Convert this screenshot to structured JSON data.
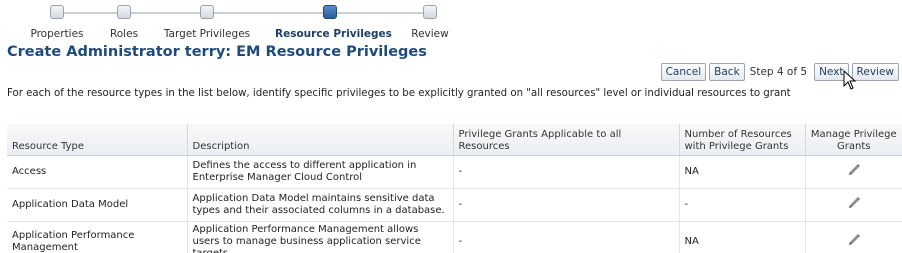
{
  "train": {
    "steps": [
      {
        "label": "Properties"
      },
      {
        "label": "Roles"
      },
      {
        "label": "Target Privileges"
      },
      {
        "label": "Resource Privileges"
      },
      {
        "label": "Review"
      }
    ],
    "current_index": 3
  },
  "page_title": "Create Administrator terry: EM Resource Privileges",
  "buttons": {
    "cancel": "Cancel",
    "back": "Back",
    "step_text": "Step 4 of 5",
    "next": "Next",
    "review": "Review"
  },
  "instructions": "For each of the resource types in the list below, identify specific privileges to be explicitly granted on \"all resources\" level or individual resources to grant",
  "table": {
    "columns": {
      "resource_type": "Resource Type",
      "description": "Description",
      "privilege_grants": "Privilege Grants Applicable to all Resources",
      "num_resources": "Number of Resources with Privilege Grants",
      "manage": "Manage Privilege Grants"
    },
    "rows": [
      {
        "resource_type": "Access",
        "description": "Defines the access to different application in Enterprise Manager Cloud Control",
        "privilege_grants": "-",
        "num_resources": "NA",
        "manage_icon": "pencil-icon"
      },
      {
        "resource_type": "Application Data Model",
        "description": "Application Data Model maintains sensitive data types and their associated columns in a database.",
        "privilege_grants": "-",
        "num_resources": "-",
        "manage_icon": "pencil-icon"
      },
      {
        "resource_type": "Application Performance Management",
        "description": "Application Performance Management allows users to manage business application service targets",
        "privilege_grants": "-",
        "num_resources": "NA",
        "manage_icon": "pencil-icon"
      }
    ]
  },
  "colors": {
    "title": "#1f4a7e",
    "current_step": "#2b5c9a"
  }
}
